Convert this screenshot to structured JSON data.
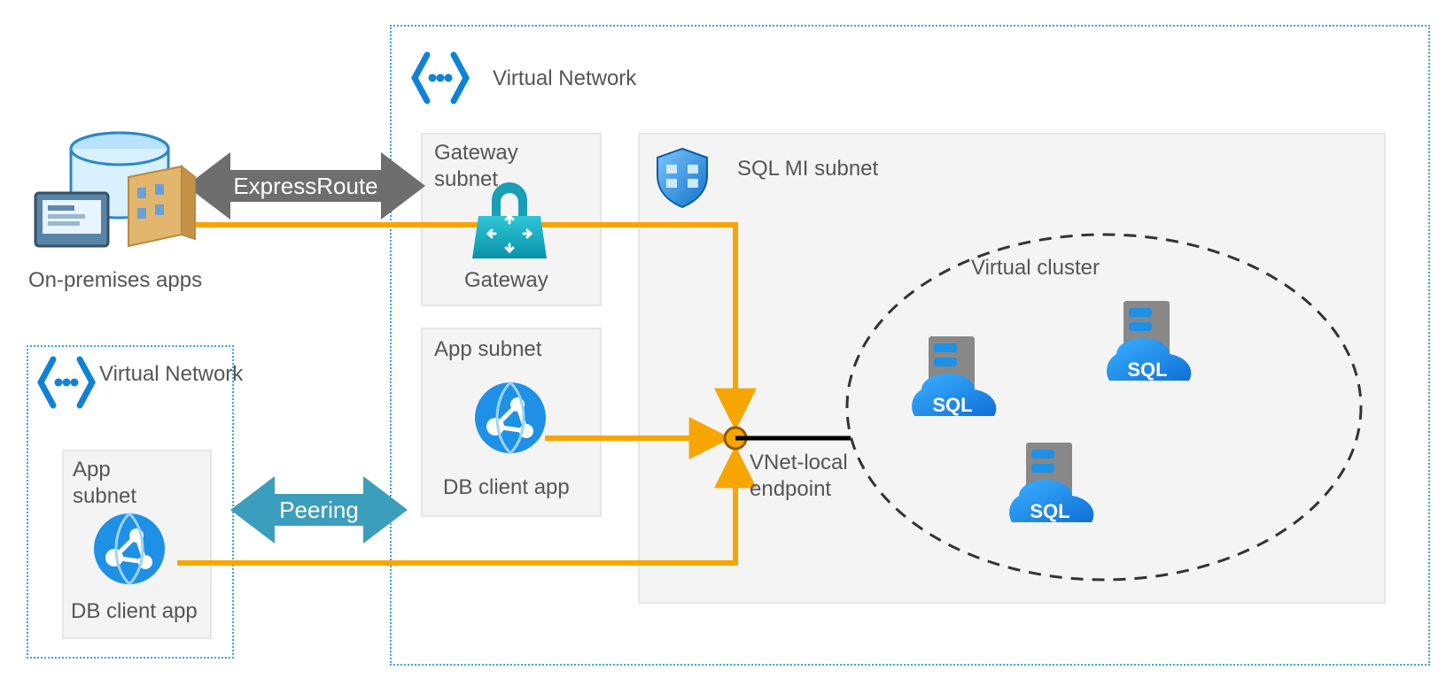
{
  "diagram": {
    "vnet_main_label": "Virtual Network",
    "vnet_left_label": "Virtual Network",
    "on_prem_label": "On-premises apps",
    "gateway_subnet_title": "Gateway\nsubnet",
    "gateway_label": "Gateway",
    "app_subnet_main_title": "App subnet",
    "app_subnet_left_title": "App\nsubnet",
    "db_client_main": "DB client app",
    "db_client_left": "DB client app",
    "sql_subnet_title": "SQL MI subnet",
    "virtual_cluster_label": "Virtual cluster",
    "endpoint_label": "VNet-local\nendpoint",
    "expressroute_label": "ExpressRoute",
    "peering_label": "Peering",
    "sql_text": "SQL"
  },
  "colors": {
    "azure_blue": "#1e90ff",
    "teal": "#3b9ebc",
    "gold": "#f7a600",
    "grey_arrow": "#6e6e6e"
  }
}
